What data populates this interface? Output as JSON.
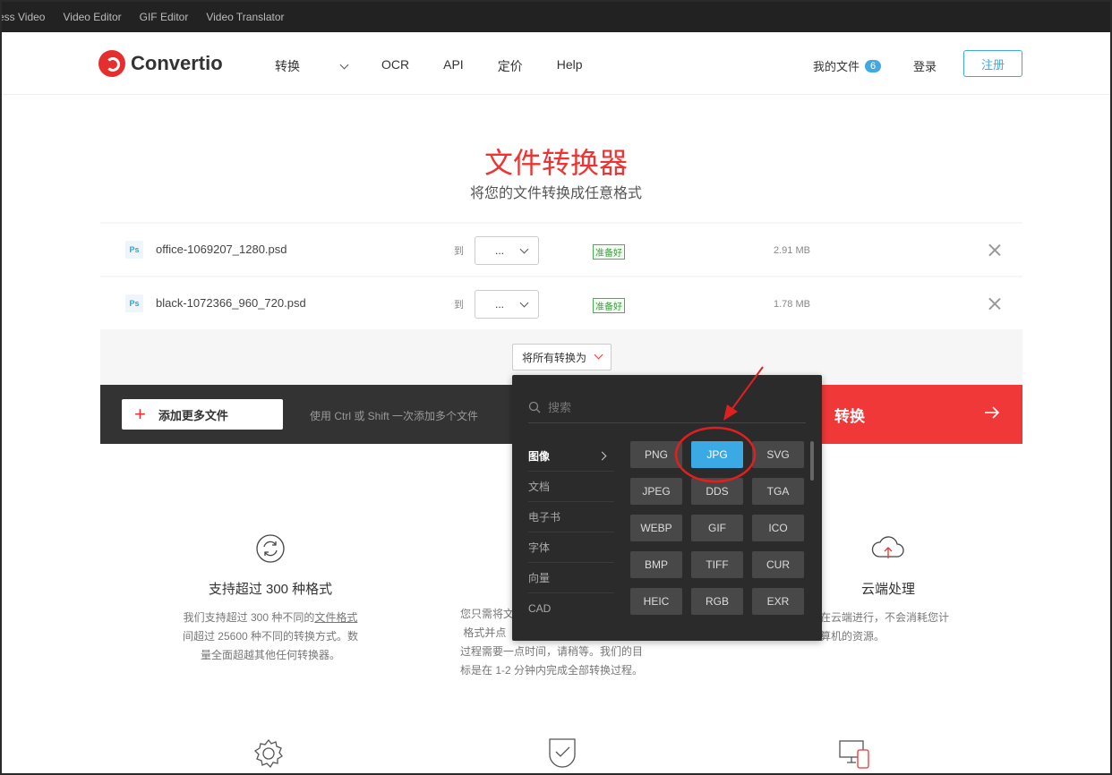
{
  "topstrip": [
    "ess Video",
    "Video Editor",
    "GIF Editor",
    "Video Translator"
  ],
  "header": {
    "logo": "Convertio",
    "nav": [
      "转换",
      "OCR",
      "API",
      "定价",
      "Help"
    ],
    "my_files": "我的文件",
    "my_files_count": "6",
    "login": "登录",
    "signup": "注册"
  },
  "hero": {
    "title": "文件转换器",
    "subtitle": "将您的文件转换成任意格式"
  },
  "files": [
    {
      "icon": "Ps",
      "name": "office-1069207_1280.psd",
      "to": "到",
      "target": "...",
      "status": "准备好",
      "size": "2.91 MB"
    },
    {
      "icon": "Ps",
      "name": "black-1072366_960_720.psd",
      "to": "到",
      "target": "...",
      "status": "准备好",
      "size": "1.78 MB"
    }
  ],
  "convert_all": "将所有转换为",
  "add_more": "添加更多文件",
  "hint": "使用 Ctrl 或 Shift 一次添加多个文件",
  "convert": "转换",
  "dropdown": {
    "search_placeholder": "搜索",
    "categories": [
      "图像",
      "文档",
      "电子书",
      "字体",
      "向量",
      "CAD"
    ],
    "formats": [
      "PNG",
      "JPG",
      "SVG",
      "JPEG",
      "DDS",
      "TGA",
      "WEBP",
      "GIF",
      "ICO",
      "BMP",
      "TIFF",
      "CUR",
      "HEIC",
      "RGB",
      "EXR"
    ],
    "selected": "JPG"
  },
  "features": [
    {
      "title": "支持超过 300 种格式",
      "p1": "我们支持超过 300 种不同的",
      "link": "文件格式",
      "p2": "间超过 25600 种不同的转换方式。数",
      "p3": "量全面超越其他任何转换器。"
    },
    {
      "p1": "您只需将文",
      "p2": "格式并点",
      "p3": "过程需要一点时间，请稍等。我们的目",
      "p4": "标是在 1-2 分钟内完成全部转换过程。"
    },
    {
      "title": "云端处理",
      "p1": "在云端进行，不会消耗您计",
      "p2": "算机的资源。"
    }
  ],
  "colors": {
    "accent": "#f03838",
    "blue": "#3ba9e3",
    "dark": "#333333"
  }
}
